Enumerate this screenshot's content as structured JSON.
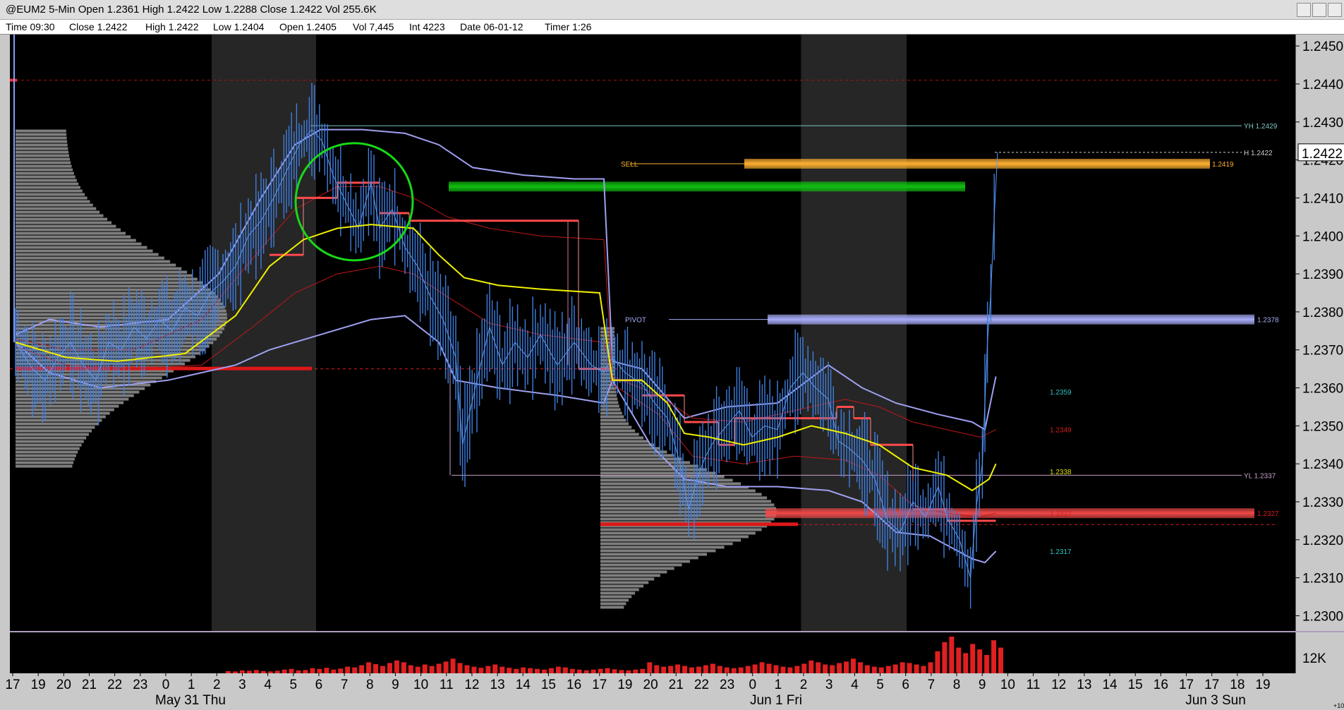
{
  "window": {
    "title": "@EUM2 5-Min  Open 1.2361  High 1.2422  Low 1.2288  Close 1.2422  Vol 255.6K"
  },
  "infobar": {
    "time": "Time 09:30",
    "close": "Close 1.2422",
    "high": "High 1.2422",
    "low": "Low 1.2404",
    "open": "Open 1.2405",
    "vol": "Vol 7,445",
    "int": "Int 4223",
    "date": "Date 06-01-12",
    "timer": "Timer 1:26"
  },
  "colors": {
    "background": "#000000",
    "price_bars": "#3f7fe0",
    "vwap": "#f0f000",
    "bands_red": "#c01818",
    "bands_blue": "#9fa0f0",
    "profile": "#8c8c8c",
    "poc": "#dd1818",
    "session_shade": "#262626",
    "sell_zone": "#ffb030",
    "green_zone": "#10c010",
    "pivot_zone": "#a8acf8",
    "red_zone": "#f04848",
    "circle": "#18d818",
    "volume": "#e02020",
    "current_price_box": "#ffffff"
  },
  "chart_data": {
    "type": "line",
    "instrument": "@EUM2",
    "timeframe": "5-Min",
    "ylim": [
      1.2296,
      1.2453
    ],
    "price_ticks": [
      "1.2450",
      "1.2440",
      "1.2430",
      "1.2420",
      "1.2410",
      "1.2400",
      "1.2390",
      "1.2380",
      "1.2370",
      "1.2360",
      "1.2350",
      "1.2340",
      "1.2330",
      "1.2320",
      "1.2310",
      "1.2300"
    ],
    "current_price": "1.2422",
    "volume_tick": "12K",
    "volume_sub": "+10",
    "time_ticks": [
      "17",
      "19",
      "20",
      "21",
      "22",
      "23",
      "0",
      "1",
      "2",
      "3",
      "4",
      "5",
      "6",
      "7",
      "8",
      "9",
      "10",
      "11",
      "12",
      "13",
      "14",
      "15",
      "16",
      "17",
      "19",
      "20",
      "21",
      "22",
      "23",
      "0",
      "1",
      "2",
      "3",
      "4",
      "5",
      "6",
      "7",
      "8",
      "9",
      "10",
      "11",
      "12",
      "13",
      "14",
      "15",
      "16",
      "17",
      "17",
      "18",
      "19"
    ],
    "date_labels": [
      "May 31 Thu",
      "Jun 1 Fri",
      "Jun 3 Sun"
    ],
    "levels": [
      {
        "label": "YH 1.2429",
        "price": 1.2429,
        "color": "#7ec8c8"
      },
      {
        "label": "H 1.2422",
        "price": 1.2422,
        "color": "#d0d0d0"
      },
      {
        "label": "YL 1.2337",
        "price": 1.2337,
        "color": "#c8a0c8"
      }
    ],
    "zones": [
      {
        "label": "SELL",
        "value_label": "1.2419",
        "price": 1.2419,
        "color": "#ffb030"
      },
      {
        "label": "PIVOT",
        "value_label": "1.2378",
        "price": 1.2378,
        "color": "#a8acf8"
      },
      {
        "label": "",
        "value_label": "1.2327",
        "price": 1.2327,
        "color": "#f04848"
      },
      {
        "label": "",
        "value_label": "",
        "price": 1.2413,
        "color": "#10c010"
      }
    ],
    "band_labels": [
      {
        "text": "1.2359",
        "price": 1.2359,
        "color": "#30c0c0"
      },
      {
        "text": "1.2349",
        "price": 1.2349,
        "color": "#d02020"
      },
      {
        "text": "1.2338",
        "price": 1.2338,
        "color": "#e0e000"
      },
      {
        "text": "1.2327",
        "price": 1.2327,
        "color": "#d02020"
      },
      {
        "text": "1.2317",
        "price": 1.2317,
        "color": "#30c0c0"
      }
    ],
    "price_path": [
      [
        0,
        1.2372
      ],
      [
        20,
        1.2365
      ],
      [
        35,
        1.2362
      ],
      [
        50,
        1.2368
      ],
      [
        65,
        1.2372
      ],
      [
        80,
        1.2366
      ],
      [
        95,
        1.2362
      ],
      [
        110,
        1.2372
      ],
      [
        125,
        1.237
      ],
      [
        140,
        1.2376
      ],
      [
        155,
        1.2373
      ],
      [
        170,
        1.2378
      ],
      [
        185,
        1.2375
      ],
      [
        200,
        1.2381
      ],
      [
        215,
        1.2379
      ],
      [
        230,
        1.2385
      ],
      [
        245,
        1.2388
      ],
      [
        260,
        1.2392
      ],
      [
        275,
        1.24
      ],
      [
        290,
        1.2404
      ],
      [
        305,
        1.241
      ],
      [
        320,
        1.2417
      ],
      [
        335,
        1.2424
      ],
      [
        350,
        1.2428
      ],
      [
        362,
        1.2425
      ],
      [
        375,
        1.2416
      ],
      [
        390,
        1.2409
      ],
      [
        405,
        1.2402
      ],
      [
        420,
        1.2414
      ],
      [
        430,
        1.2402
      ],
      [
        445,
        1.2407
      ],
      [
        460,
        1.2397
      ],
      [
        475,
        1.2392
      ],
      [
        490,
        1.2384
      ],
      [
        505,
        1.2378
      ],
      [
        520,
        1.2368
      ],
      [
        528,
        1.2345
      ],
      [
        545,
        1.2362
      ],
      [
        560,
        1.2376
      ],
      [
        575,
        1.2366
      ],
      [
        590,
        1.2372
      ],
      [
        605,
        1.2368
      ],
      [
        620,
        1.2374
      ],
      [
        640,
        1.2366
      ],
      [
        660,
        1.2372
      ],
      [
        680,
        1.2366
      ],
      [
        695,
        1.2364
      ],
      [
        705,
        1.2368
      ],
      [
        720,
        1.2364
      ],
      [
        740,
        1.2361
      ],
      [
        755,
        1.2356
      ],
      [
        770,
        1.2352
      ],
      [
        785,
        1.234
      ],
      [
        795,
        1.2328
      ],
      [
        805,
        1.2336
      ],
      [
        815,
        1.2342
      ],
      [
        825,
        1.2346
      ],
      [
        840,
        1.235
      ],
      [
        855,
        1.2354
      ],
      [
        870,
        1.2347
      ],
      [
        885,
        1.235
      ],
      [
        900,
        1.2349
      ],
      [
        915,
        1.236
      ],
      [
        930,
        1.2364
      ],
      [
        945,
        1.236
      ],
      [
        960,
        1.2357
      ],
      [
        972,
        1.2346
      ],
      [
        985,
        1.2344
      ],
      [
        1000,
        1.2341
      ],
      [
        1015,
        1.2336
      ],
      [
        1030,
        1.2325
      ],
      [
        1045,
        1.2322
      ],
      [
        1060,
        1.233
      ],
      [
        1075,
        1.2326
      ],
      [
        1090,
        1.2334
      ],
      [
        1100,
        1.2326
      ],
      [
        1115,
        1.232
      ],
      [
        1128,
        1.231
      ],
      [
        1135,
        1.2329
      ],
      [
        1142,
        1.234
      ],
      [
        1148,
        1.2372
      ],
      [
        1152,
        1.2385
      ],
      [
        1156,
        1.2405
      ],
      [
        1160,
        1.2422
      ]
    ],
    "vwap_path": [
      [
        0,
        1.2372
      ],
      [
        60,
        1.2368
      ],
      [
        120,
        1.2367
      ],
      [
        200,
        1.2369
      ],
      [
        260,
        1.2379
      ],
      [
        300,
        1.2392
      ],
      [
        340,
        1.2399
      ],
      [
        380,
        1.2402
      ],
      [
        420,
        1.2403
      ],
      [
        470,
        1.2402
      ],
      [
        500,
        1.2395
      ],
      [
        530,
        1.2389
      ],
      [
        570,
        1.2387
      ],
      [
        620,
        1.2386
      ],
      [
        690,
        1.2385
      ],
      [
        705,
        1.2362
      ],
      [
        740,
        1.2362
      ],
      [
        770,
        1.2356
      ],
      [
        790,
        1.2348
      ],
      [
        820,
        1.2347
      ],
      [
        860,
        1.2345
      ],
      [
        900,
        1.2347
      ],
      [
        940,
        1.235
      ],
      [
        980,
        1.2348
      ],
      [
        1020,
        1.2345
      ],
      [
        1060,
        1.2339
      ],
      [
        1100,
        1.2337
      ],
      [
        1130,
        1.2333
      ],
      [
        1150,
        1.2336
      ],
      [
        1158,
        1.234
      ]
    ],
    "band_upper_outer": [
      [
        0,
        1.2374
      ],
      [
        40,
        1.2378
      ],
      [
        100,
        1.2376
      ],
      [
        180,
        1.2378
      ],
      [
        240,
        1.239
      ],
      [
        290,
        1.241
      ],
      [
        330,
        1.2424
      ],
      [
        360,
        1.2428
      ],
      [
        410,
        1.2428
      ],
      [
        460,
        1.2427
      ],
      [
        500,
        1.2424
      ],
      [
        540,
        1.2418
      ],
      [
        600,
        1.2416
      ],
      [
        660,
        1.2415
      ],
      [
        695,
        1.2415
      ],
      [
        705,
        1.2367
      ],
      [
        740,
        1.2365
      ],
      [
        790,
        1.2352
      ],
      [
        840,
        1.2355
      ],
      [
        900,
        1.2356
      ],
      [
        960,
        1.2366
      ],
      [
        1000,
        1.236
      ],
      [
        1040,
        1.2356
      ],
      [
        1090,
        1.2353
      ],
      [
        1130,
        1.2351
      ],
      [
        1145,
        1.2349
      ],
      [
        1158,
        1.2363
      ]
    ],
    "band_lower_outer": [
      [
        0,
        1.2372
      ],
      [
        40,
        1.2364
      ],
      [
        100,
        1.236
      ],
      [
        180,
        1.2362
      ],
      [
        260,
        1.2366
      ],
      [
        300,
        1.237
      ],
      [
        360,
        1.2374
      ],
      [
        420,
        1.2378
      ],
      [
        460,
        1.2379
      ],
      [
        500,
        1.2372
      ],
      [
        520,
        1.2362
      ],
      [
        570,
        1.236
      ],
      [
        640,
        1.2358
      ],
      [
        695,
        1.2356
      ],
      [
        705,
        1.2362
      ],
      [
        750,
        1.2345
      ],
      [
        790,
        1.2336
      ],
      [
        840,
        1.2334
      ],
      [
        900,
        1.2334
      ],
      [
        960,
        1.2333
      ],
      [
        1000,
        1.233
      ],
      [
        1040,
        1.2322
      ],
      [
        1080,
        1.2321
      ],
      [
        1130,
        1.2315
      ],
      [
        1145,
        1.2314
      ],
      [
        1158,
        1.2317
      ]
    ],
    "band_upper_inner": [
      [
        0,
        1.2373
      ],
      [
        60,
        1.237
      ],
      [
        140,
        1.237
      ],
      [
        220,
        1.2378
      ],
      [
        280,
        1.2394
      ],
      [
        330,
        1.2407
      ],
      [
        380,
        1.2413
      ],
      [
        430,
        1.2413
      ],
      [
        470,
        1.241
      ],
      [
        510,
        1.2405
      ],
      [
        560,
        1.2402
      ],
      [
        620,
        1.24
      ],
      [
        695,
        1.2399
      ],
      [
        705,
        1.2363
      ],
      [
        760,
        1.2358
      ],
      [
        800,
        1.2352
      ],
      [
        860,
        1.2351
      ],
      [
        920,
        1.2354
      ],
      [
        980,
        1.2357
      ],
      [
        1020,
        1.2355
      ],
      [
        1060,
        1.2351
      ],
      [
        1100,
        1.2349
      ],
      [
        1140,
        1.2347
      ],
      [
        1158,
        1.2349
      ]
    ],
    "band_lower_inner": [
      [
        0,
        1.2371
      ],
      [
        60,
        1.2366
      ],
      [
        140,
        1.2365
      ],
      [
        220,
        1.2366
      ],
      [
        280,
        1.2376
      ],
      [
        330,
        1.2385
      ],
      [
        380,
        1.239
      ],
      [
        430,
        1.2392
      ],
      [
        470,
        1.239
      ],
      [
        510,
        1.2384
      ],
      [
        560,
        1.2377
      ],
      [
        620,
        1.2374
      ],
      [
        695,
        1.2372
      ],
      [
        705,
        1.2361
      ],
      [
        760,
        1.2353
      ],
      [
        800,
        1.2342
      ],
      [
        860,
        1.234
      ],
      [
        920,
        1.2342
      ],
      [
        980,
        1.2341
      ],
      [
        1020,
        1.2337
      ],
      [
        1060,
        1.2329
      ],
      [
        1100,
        1.2327
      ],
      [
        1140,
        1.2326
      ],
      [
        1158,
        1.2327
      ]
    ],
    "poc_steps": [
      [
        300,
        1.2395,
        340
      ],
      [
        330,
        1.241,
        380
      ],
      [
        380,
        1.2414,
        430
      ],
      [
        430,
        1.2406,
        465
      ],
      [
        465,
        1.2404,
        665
      ],
      [
        665,
        1.2365,
        705
      ],
      [
        705,
        1.2362,
        740
      ],
      [
        740,
        1.2358,
        790
      ],
      [
        790,
        1.2351,
        830
      ],
      [
        830,
        1.2345,
        850
      ],
      [
        850,
        1.2352,
        940
      ],
      [
        940,
        1.2352,
        970
      ],
      [
        970,
        1.2355,
        990
      ],
      [
        990,
        1.2352,
        1010
      ],
      [
        1010,
        1.2345,
        1060
      ],
      [
        1060,
        1.2328,
        1100
      ],
      [
        1100,
        1.2325,
        1158
      ]
    ],
    "volume": [
      0.06,
      0.05,
      0.08,
      0.07,
      0.09,
      0.06,
      0.05,
      0.07,
      0.1,
      0.12,
      0.08,
      0.09,
      0.14,
      0.12,
      0.15,
      0.1,
      0.13,
      0.18,
      0.16,
      0.22,
      0.3,
      0.25,
      0.2,
      0.28,
      0.35,
      0.3,
      0.22,
      0.18,
      0.24,
      0.2,
      0.26,
      0.32,
      0.4,
      0.28,
      0.22,
      0.18,
      0.15,
      0.2,
      0.24,
      0.18,
      0.15,
      0.12,
      0.16,
      0.14,
      0.12,
      0.1,
      0.14,
      0.18,
      0.16,
      0.12,
      0.1,
      0.08,
      0.1,
      0.12,
      0.14,
      0.11,
      0.09,
      0.08,
      0.1,
      0.12,
      0.3,
      0.22,
      0.18,
      0.2,
      0.24,
      0.2,
      0.16,
      0.18,
      0.22,
      0.26,
      0.2,
      0.16,
      0.14,
      0.16,
      0.2,
      0.24,
      0.3,
      0.26,
      0.22,
      0.18,
      0.16,
      0.2,
      0.26,
      0.35,
      0.3,
      0.24,
      0.22,
      0.28,
      0.32,
      0.4,
      0.3,
      0.22,
      0.18,
      0.16,
      0.2,
      0.24,
      0.3,
      0.28,
      0.24,
      0.2,
      0.3,
      0.6,
      0.85,
      1.0,
      0.7,
      0.55,
      0.8,
      0.65,
      0.5,
      0.9,
      0.7
    ]
  }
}
